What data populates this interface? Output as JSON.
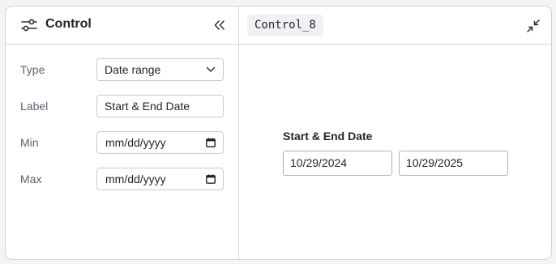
{
  "panel": {
    "title": "Control",
    "icons": {
      "title_icon": "sliders-icon",
      "collapse": "chevrons-left-icon"
    }
  },
  "form": {
    "type_label": "Type",
    "type_value": "Date range",
    "label_label": "Label",
    "label_value": "Start & End Date",
    "min_label": "Min",
    "min_value": "mm/dd/yyyy",
    "max_label": "Max",
    "max_value": "mm/dd/yyyy"
  },
  "preview": {
    "tag": "Control_8",
    "expand_icon": "minimize-icon",
    "label": "Start & End Date",
    "start_date": "10/29/2024",
    "end_date": "10/29/2025"
  }
}
